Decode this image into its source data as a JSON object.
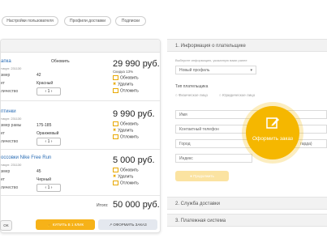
{
  "top_tabs": [
    "Настройки пользователя",
    "Профили доставки",
    "Подписки"
  ],
  "cart": {
    "items": [
      {
        "name": "апка",
        "article": "тикул: 231130",
        "status": "Обновить",
        "rows": [
          {
            "label": "змер",
            "value": "42"
          },
          {
            "label": "ет",
            "value": "Красный"
          },
          {
            "label": "личество",
            "value": "1"
          }
        ],
        "price": "29 990 руб.",
        "discount": "Скидка 13%",
        "actions": [
          "Обновить",
          "Удалить",
          "Отложить"
        ]
      },
      {
        "name": "птинки",
        "article": "тикул: 231130",
        "rows": [
          {
            "label": "змер рамы",
            "value": "175-185"
          },
          {
            "label": "ет",
            "value": "Оранжевый"
          },
          {
            "label": "личество",
            "value": "1"
          }
        ],
        "price": "9 990 руб.",
        "actions": [
          "Обновить",
          "Удалить",
          "Отложить"
        ]
      },
      {
        "name": "оссовки Nike Free Run",
        "article": "тикул: 231130",
        "rows": [
          {
            "label": "змер",
            "value": "45"
          },
          {
            "label": "ет",
            "value": "Черный"
          },
          {
            "label": "личество",
            "value": "1"
          }
        ],
        "price": "5 000 руб.",
        "actions": [
          "Обновить",
          "Удалить",
          "Отложить"
        ]
      }
    ],
    "total_label": "Итого:",
    "total_value": "50 000 руб.",
    "ok_label": "OK",
    "buy_label": "КУПИТЬ В 1 КЛИК",
    "checkout_label": "ОФОРМИТЬ ЗАКАЗ"
  },
  "payer": {
    "section1": "1. Информация о плательщике",
    "choose_hint": "Выберите информацию, указанную вами ранее",
    "profile_value": "Новый профиль",
    "payer_type_label": "Тип плательщика",
    "radio_individual": "Физическое лицо",
    "radio_legal": "Юридическое лицо",
    "fields": [
      "Имя",
      "Контактный телефон",
      "Город",
      "Индекс"
    ],
    "city_hint": "гарда)",
    "continue_label": "Продолжить",
    "section2": "2. Служба доставки",
    "section3": "3. Платежная система",
    "badge_label": "Оформить заказ"
  }
}
